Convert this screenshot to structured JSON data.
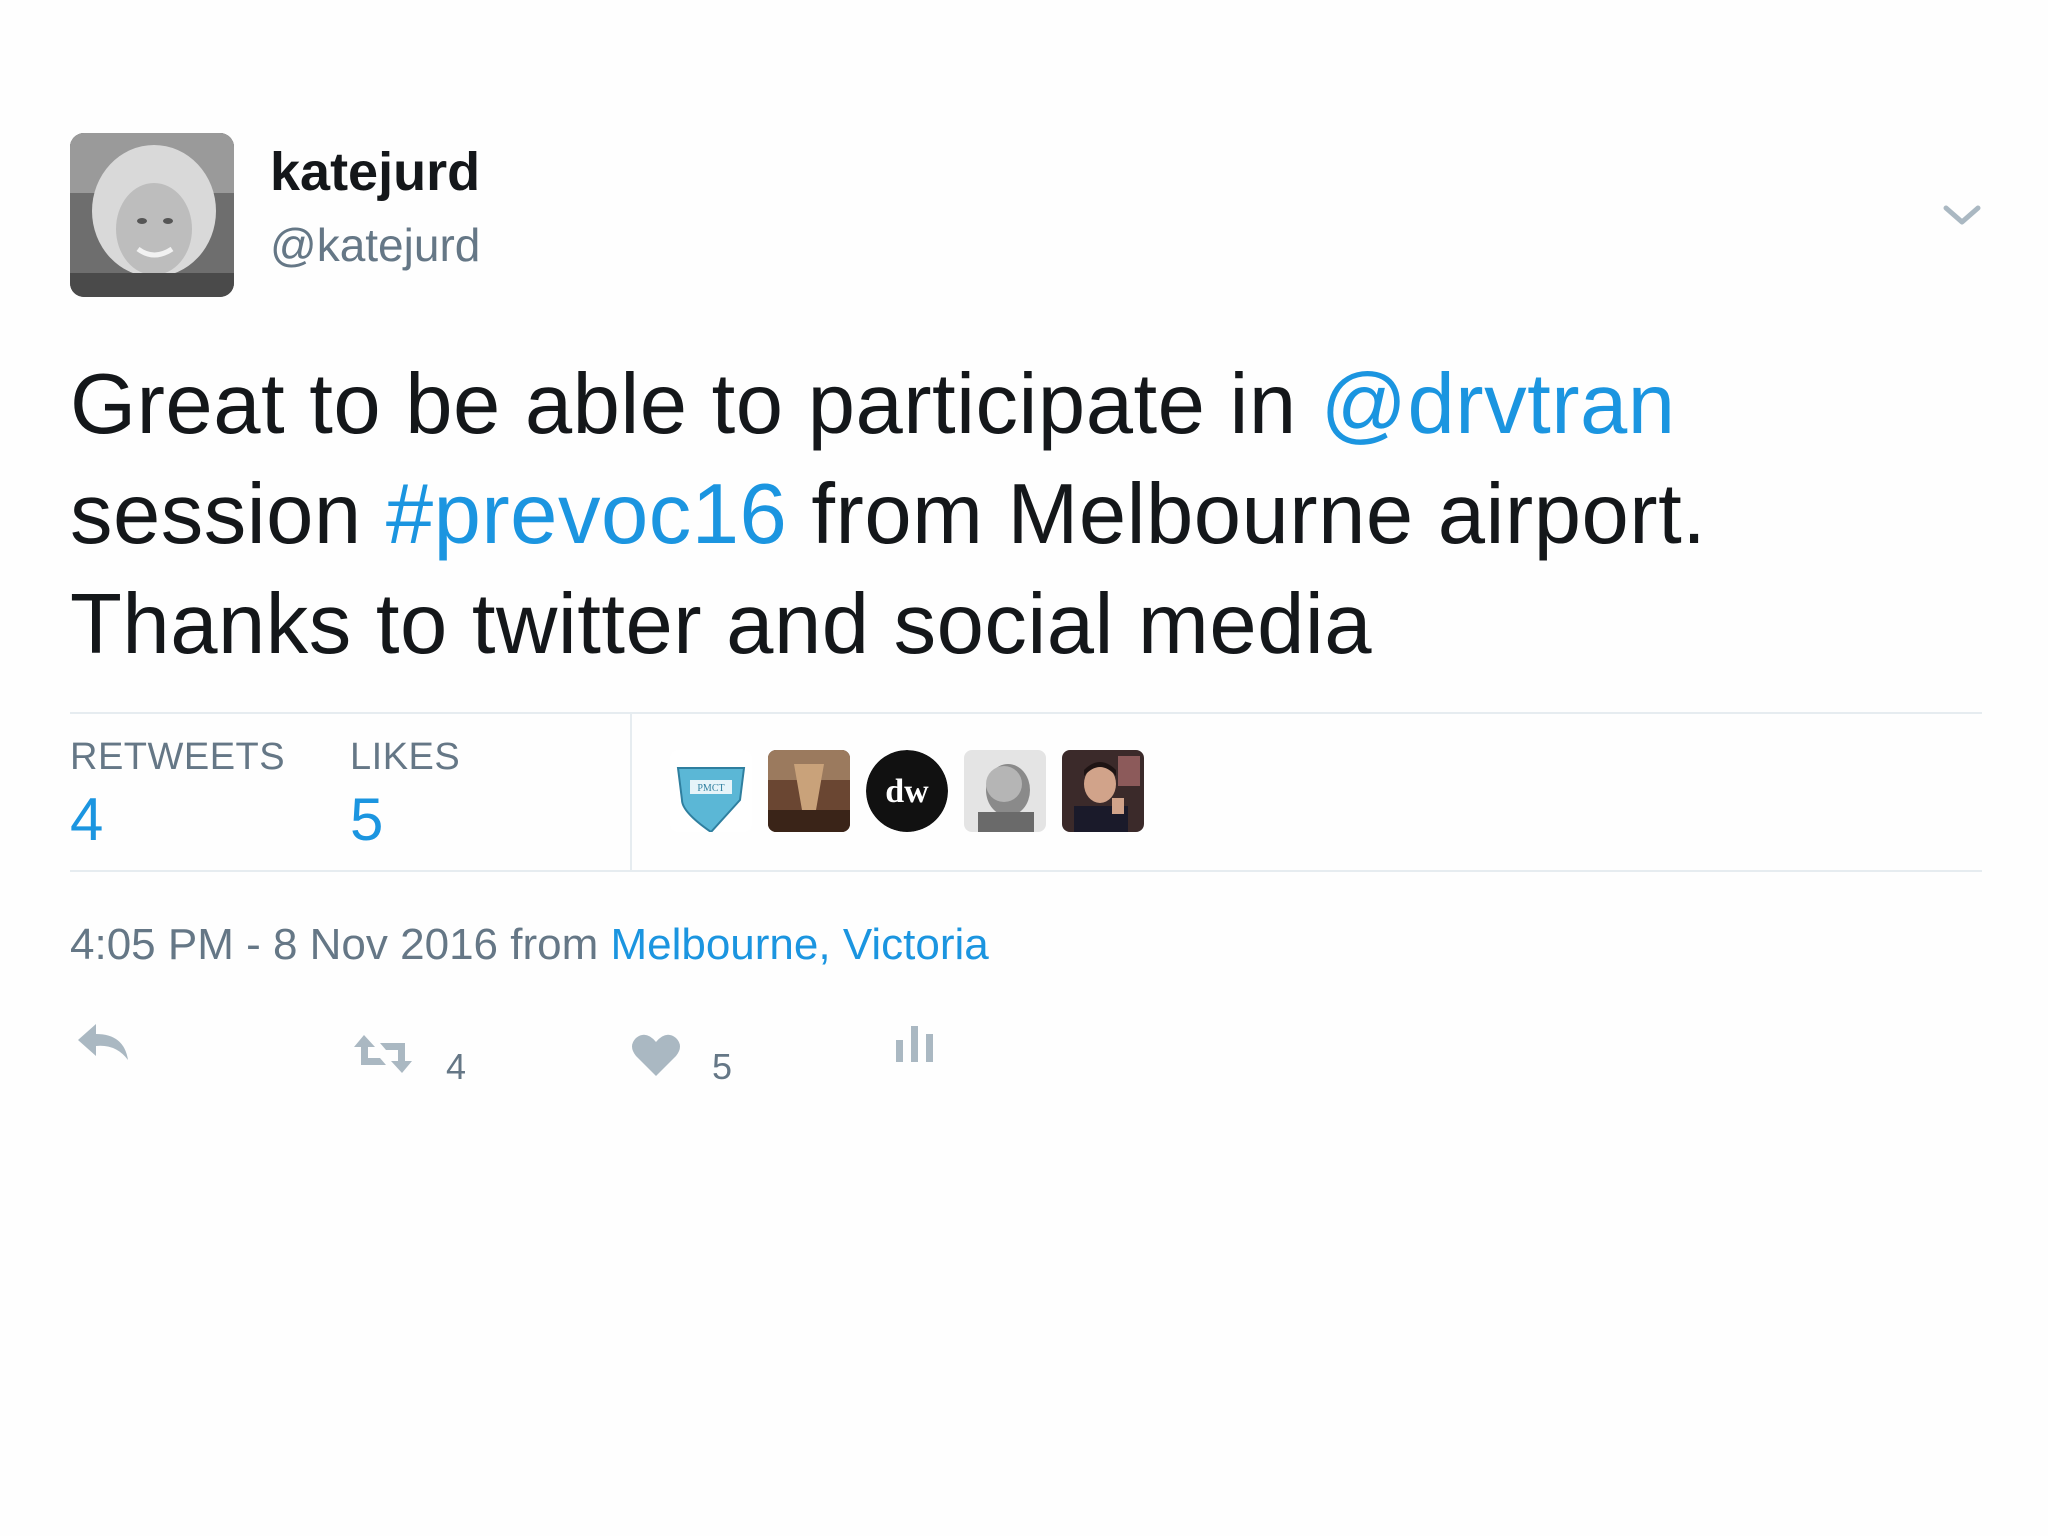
{
  "author": {
    "display_name": "katejurd",
    "handle": "@katejurd",
    "avatar_icon": "user-avatar-photo"
  },
  "tweet": {
    "text_parts": [
      {
        "text": "Great to be able to participate in ",
        "link": false
      },
      {
        "text": "@drvtran",
        "link": true
      },
      {
        "text": " session ",
        "link": false
      },
      {
        "text": "#prevoc16",
        "link": true
      },
      {
        "text": "  from Melbourne airport. Thanks to twitter and social media",
        "link": false
      }
    ]
  },
  "stats": {
    "retweets_label": "RETWEETS",
    "retweets_value": "4",
    "likes_label": "LIKES",
    "likes_value": "5"
  },
  "likers": [
    {
      "name": "liker-avatar-1",
      "badge": "PMCT"
    },
    {
      "name": "liker-avatar-2"
    },
    {
      "name": "liker-avatar-3",
      "badge": "dw"
    },
    {
      "name": "liker-avatar-4"
    },
    {
      "name": "liker-avatar-5"
    }
  ],
  "meta": {
    "timestamp": "4:05 PM - 8 Nov 2016",
    "from_label": " from ",
    "place": "Melbourne, Victoria"
  },
  "actions": {
    "retweet_count": "4",
    "like_count": "5"
  },
  "colors": {
    "link": "#1b95e0",
    "muted": "#657786",
    "text": "#14171a",
    "divider": "#e6ecf0",
    "icon": "#aab8c2"
  }
}
